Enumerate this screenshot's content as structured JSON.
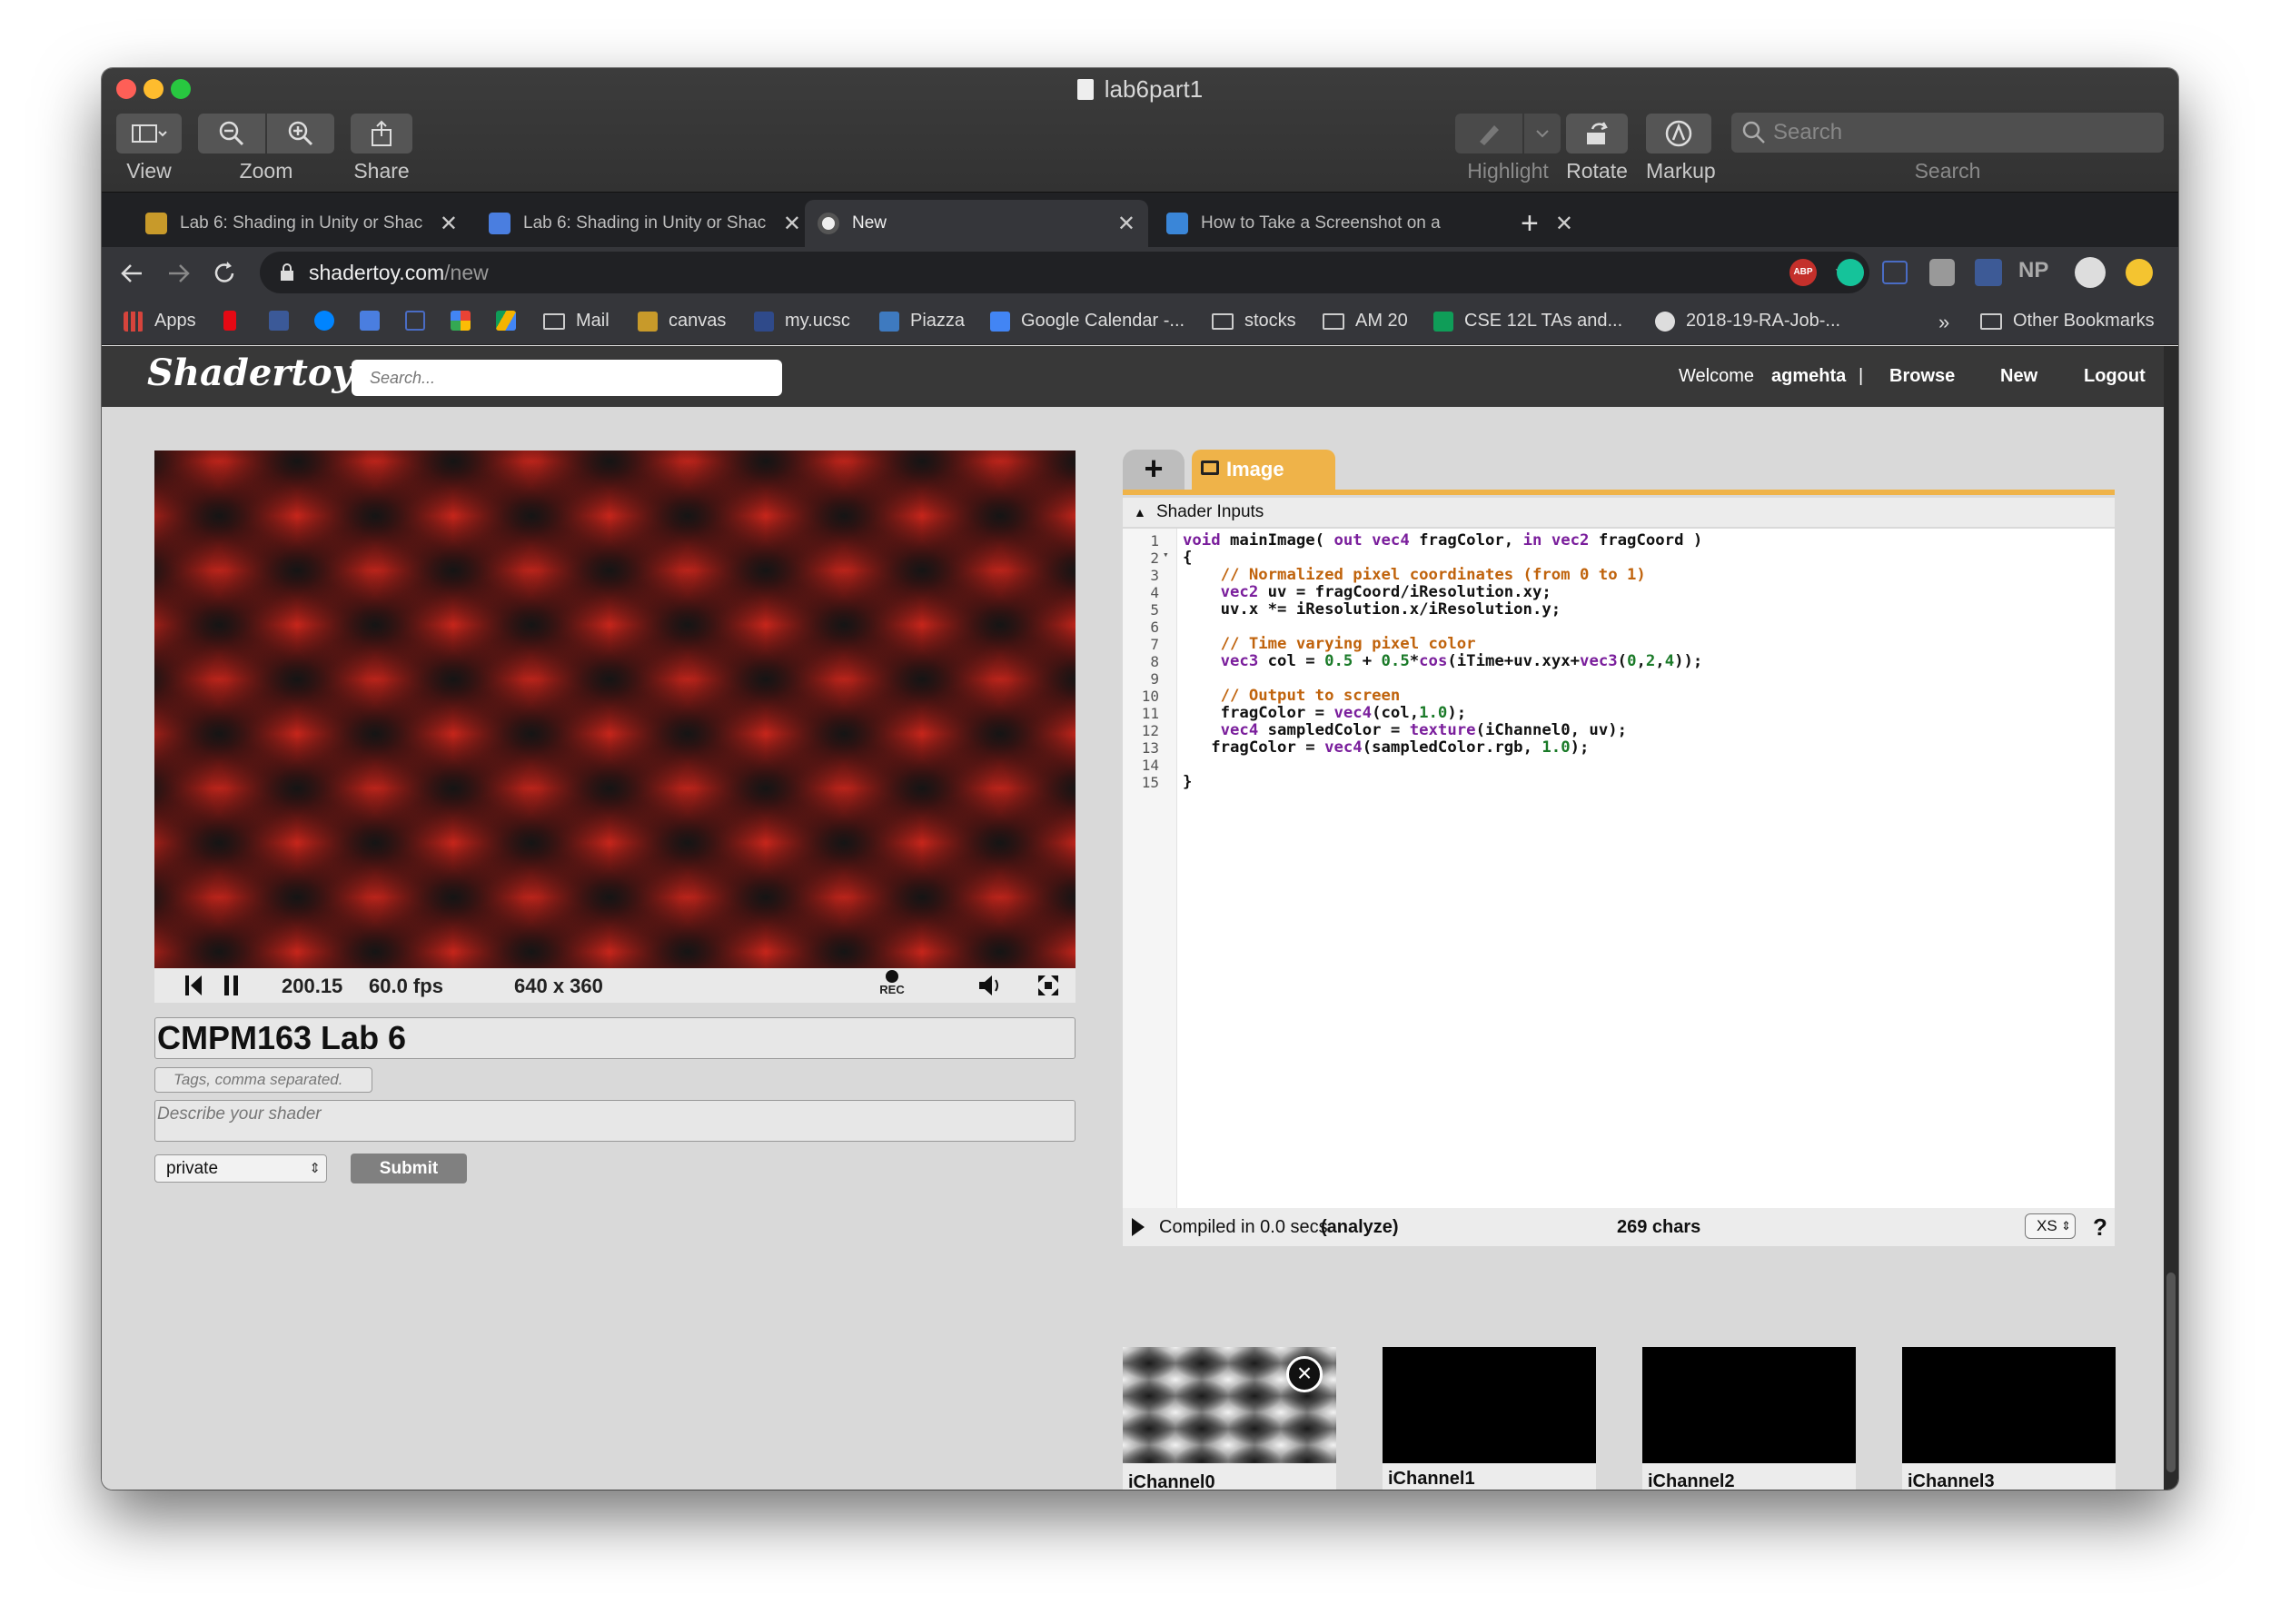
{
  "preview_app": {
    "window_title": "lab6part1",
    "toolbar": {
      "view_label": "View",
      "zoom_label": "Zoom",
      "share_label": "Share",
      "highlight_label": "Highlight",
      "rotate_label": "Rotate",
      "markup_label": "Markup",
      "search_placeholder": "Search",
      "search_label": "Search"
    }
  },
  "browser": {
    "tabs": [
      {
        "title": "Lab 6: Shading in Unity or Shac",
        "icon": "ucsc-canvas-icon",
        "active": false
      },
      {
        "title": "Lab 6: Shading in Unity or Shac",
        "icon": "google-docs-icon",
        "active": false
      },
      {
        "title": "New",
        "icon": "shadertoy-icon",
        "active": true
      },
      {
        "title": "How to Take a Screenshot on a",
        "icon": "tutorial-icon",
        "active": false
      }
    ],
    "address": {
      "domain": "shadertoy.com",
      "path": "/new"
    },
    "extensions": [
      "ABP",
      "NP"
    ],
    "bookmarks": [
      {
        "label": "Apps",
        "icon": "apps-grid-icon"
      },
      {
        "label": "",
        "icon": "netflix-icon"
      },
      {
        "label": "",
        "icon": "facebook-icon"
      },
      {
        "label": "",
        "icon": "messenger-icon"
      },
      {
        "label": "",
        "icon": "google-docs-icon"
      },
      {
        "label": "",
        "icon": "bookmark-icon"
      },
      {
        "label": "",
        "icon": "pinwheel-icon"
      },
      {
        "label": "",
        "icon": "google-drive-icon"
      },
      {
        "label": "Mail",
        "icon": "folder-icon"
      },
      {
        "label": "canvas",
        "icon": "canvas-icon"
      },
      {
        "label": "my.ucsc",
        "icon": "ucsc-icon"
      },
      {
        "label": "Piazza",
        "icon": "piazza-icon"
      },
      {
        "label": "Google Calendar -...",
        "icon": "calendar-icon"
      },
      {
        "label": "stocks",
        "icon": "folder-icon"
      },
      {
        "label": "AM 20",
        "icon": "folder-icon"
      },
      {
        "label": "CSE 12L TAs and...",
        "icon": "plus-cross-icon"
      },
      {
        "label": "2018-19-RA-Job-...",
        "icon": "globe-icon"
      }
    ],
    "overflow": "»",
    "other_bookmarks": "Other Bookmarks"
  },
  "shadertoy": {
    "logo": "Shadertoy",
    "search_placeholder": "Search...",
    "nav": {
      "welcome": "Welcome",
      "user": "agmehta",
      "separator": "|",
      "browse": "Browse",
      "new": "New",
      "logout": "Logout"
    },
    "player": {
      "time": "200.15",
      "fps": "60.0 fps",
      "resolution": "640 x 360",
      "rec": "REC"
    },
    "title": "CMPM163 Lab 6",
    "tags_placeholder": "Tags, comma separated.",
    "description_placeholder": "Describe your shader",
    "visibility": "private",
    "submit_label": "Submit",
    "editor": {
      "plus_label": "+",
      "tab_label": "Image",
      "shader_inputs_label": "Shader Inputs",
      "line_numbers": [
        "1",
        "2",
        "3",
        "4",
        "5",
        "6",
        "7",
        "8",
        "9",
        "10",
        "11",
        "12",
        "13",
        "14",
        "15"
      ],
      "compiled_prefix": "Compiled in 0.0 secs",
      "analyze_label": "(analyze)",
      "chars": "269 chars",
      "font_size_select": "XS",
      "help": "?"
    },
    "channels": [
      {
        "label": "iChannel0"
      },
      {
        "label": "iChannel1"
      },
      {
        "label": "iChannel2"
      },
      {
        "label": "iChannel3"
      }
    ]
  },
  "colors": {
    "accent_orange": "#efb349",
    "canvas_red": "#e4281c"
  }
}
